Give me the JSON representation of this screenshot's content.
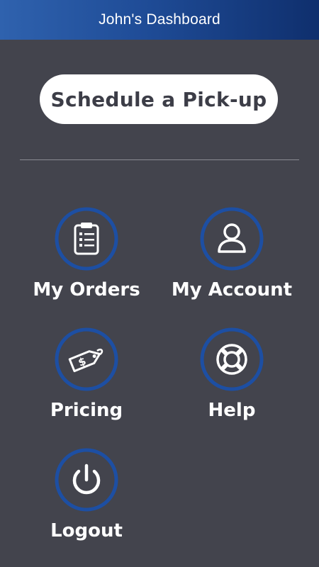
{
  "header": {
    "title": "John's Dashboard"
  },
  "pickup_button": {
    "label": "Schedule a Pick-up"
  },
  "menu": {
    "my_orders": {
      "label": "My Orders",
      "icon": "clipboard-icon"
    },
    "my_account": {
      "label": "My Account",
      "icon": "user-icon"
    },
    "pricing": {
      "label": "Pricing",
      "icon": "price-tag-icon"
    },
    "help": {
      "label": "Help",
      "icon": "lifebuoy-icon"
    },
    "logout": {
      "label": "Logout",
      "icon": "power-icon"
    }
  },
  "colors": {
    "background": "#43444d",
    "header_gradient_start": "#2f62ae",
    "header_gradient_end": "#0f2f6d",
    "ring": "#1d4fa3",
    "text": "#ffffff"
  }
}
